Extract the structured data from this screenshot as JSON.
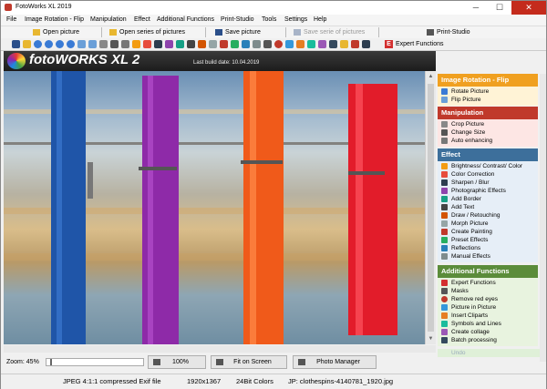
{
  "window": {
    "title": "FotoWorks XL 2019",
    "minimize": "─",
    "maximize": "☐",
    "close": "✕"
  },
  "menu": [
    "File",
    "Image Rotation - Flip",
    "Manipulation",
    "Effect",
    "Additional Functions",
    "Print-Studio",
    "Tools",
    "Settings",
    "Help"
  ],
  "mainbar": {
    "open_picture": "Open picture",
    "open_series": "Open series of pictures",
    "save_picture": "Save picture",
    "save_series": "Save serie of pictures",
    "print_studio": "Print-Studio"
  },
  "iconbar": {
    "expert_functions": "Expert Functions",
    "expert_icon": "E"
  },
  "banner": {
    "logo_text": "fotoWORKS XL 2",
    "build_date": "Last build date: 10.04.2019"
  },
  "bottom": {
    "zoom_label": "Zoom: 45%",
    "zoom_level": 0.45,
    "btn_100": "100%",
    "btn_fit": "Fit on Screen",
    "btn_photo_manager": "Photo Manager"
  },
  "status": {
    "format": "JPEG 4:1:1 compressed Exif file",
    "resolution": "1920x1367",
    "colors": "24Bit Colors",
    "filename": "JP: clothespins-4140781_1920.jpg"
  },
  "panel": {
    "rotation": {
      "title": "Image Rotation - Flip",
      "color": "#f0a020",
      "items": [
        "Rotate Picture",
        "Flip Picture"
      ]
    },
    "manipulation": {
      "title": "Manipulation",
      "color": "#c0392b",
      "items": [
        "Crop Picture",
        "Change Size",
        "Auto enhancing"
      ]
    },
    "effect": {
      "title": "Effect",
      "color": "#3d6f9b",
      "items": [
        "Brightness/ Contrast/ Color",
        "Color Correction",
        "Sharpen / Blur",
        "Photographic Effects",
        "Add Border",
        "Add Text",
        "Draw / Retouching",
        "Morph Picture",
        "Create Painting",
        "Preset Effects",
        "Reflections",
        "Manual Effects"
      ]
    },
    "additional": {
      "title": "Additional Functions",
      "color": "#5b8c3a",
      "items": [
        "Expert Functions",
        "Masks",
        "Remove red eyes",
        "Picture in Picture",
        "Insert Cliparts",
        "Symbols and Lines",
        "Create collage",
        "Batch processing"
      ]
    },
    "undo": "Undo"
  },
  "colors": {
    "pin_blue": "#2563b8",
    "pin_purple": "#8e2aa8",
    "pin_orange": "#f05a1a",
    "pin_red": "#e21c2a"
  }
}
